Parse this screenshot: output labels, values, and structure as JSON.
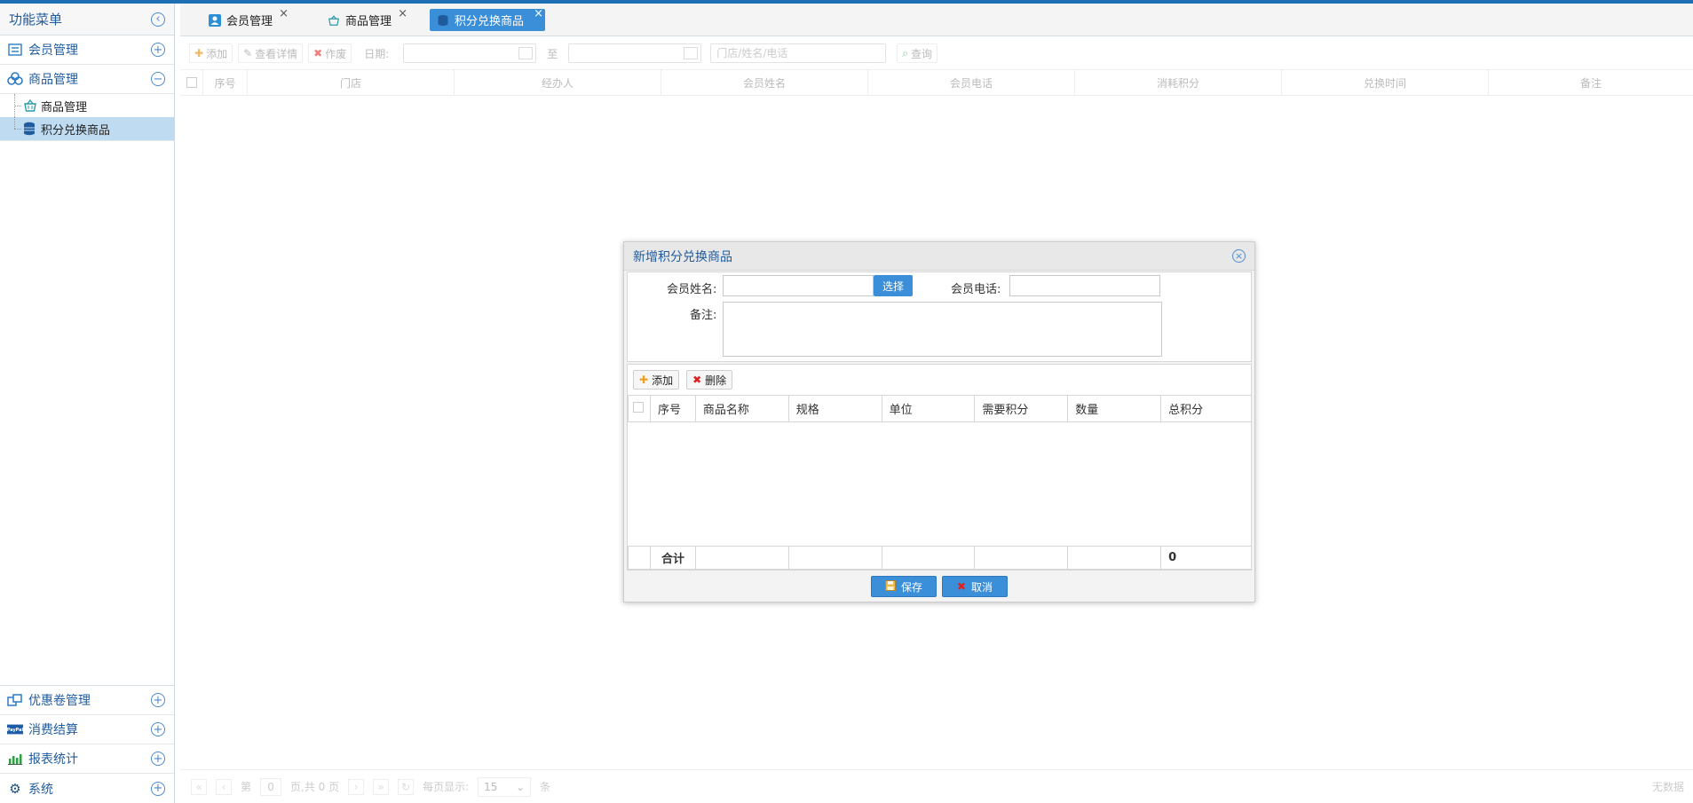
{
  "sidebar": {
    "title": "功能菜单",
    "groups": [
      {
        "label": "会员管理"
      },
      {
        "label": "商品管理"
      }
    ],
    "tree": [
      {
        "label": "商品管理"
      },
      {
        "label": "积分兑换商品"
      }
    ],
    "bottom": [
      {
        "label": "优惠卷管理"
      },
      {
        "label": "消费结算"
      },
      {
        "label": "报表统计"
      },
      {
        "label": "系统"
      }
    ]
  },
  "tabs": [
    {
      "label": "会员管理"
    },
    {
      "label": "商品管理"
    },
    {
      "label": "积分兑换商品"
    }
  ],
  "toolbar": {
    "add": "添加",
    "detail": "查看详情",
    "void": "作废",
    "date_label": "日期:",
    "to": "至",
    "search_placeholder": "门店/姓名/电话",
    "query": "查询"
  },
  "grid": {
    "columns": [
      "序号",
      "门店",
      "经办人",
      "会员姓名",
      "会员电话",
      "消耗积分",
      "兑换时间",
      "备注"
    ]
  },
  "pager": {
    "page_label": "第",
    "page_value": "0",
    "page_total": "页,共 0 页",
    "per_page_label": "每页显示:",
    "per_page_value": "15",
    "unit": "条",
    "no_data": "无数据"
  },
  "dialog": {
    "title": "新增积分兑换商品",
    "member_name_label": "会员姓名:",
    "select_button": "选择",
    "member_phone_label": "会员电话:",
    "remark_label": "备注:",
    "add_button": "添加",
    "delete_button": "删除",
    "columns": [
      "序号",
      "商品名称",
      "规格",
      "单位",
      "需要积分",
      "数量",
      "总积分"
    ],
    "sum_label": "合计",
    "sum_value": "0",
    "save_button": "保存",
    "cancel_button": "取消"
  }
}
